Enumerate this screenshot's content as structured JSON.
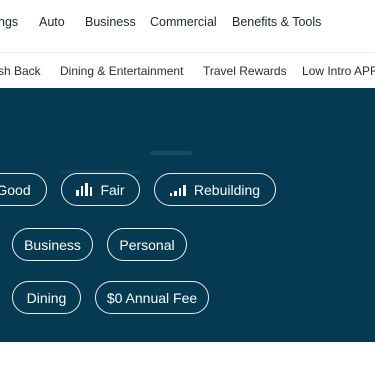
{
  "top_nav": {
    "items": [
      {
        "label": "ngs"
      },
      {
        "label": "Auto"
      },
      {
        "label": "Business"
      },
      {
        "label": "Commercial"
      },
      {
        "label": "Benefits & Tools"
      }
    ]
  },
  "sub_nav": {
    "items": [
      {
        "label": "sh Back"
      },
      {
        "label": "Dining & Entertainment"
      },
      {
        "label": "Travel Rewards"
      },
      {
        "label": "Low Intro APR"
      }
    ]
  },
  "filters": {
    "credit": [
      {
        "label": "Good",
        "icon": ""
      },
      {
        "label": "Fair",
        "icon": "bars-icon"
      },
      {
        "label": "Rebuilding",
        "icon": "bars-icon"
      }
    ],
    "type": [
      {
        "label": "Business"
      },
      {
        "label": "Personal"
      }
    ],
    "feature": [
      {
        "label": "Dining"
      },
      {
        "label": "$0 Annual Fee"
      }
    ]
  },
  "colors": {
    "panel_bg": "#063a52",
    "pill_border": "#e8eef1",
    "text_dark": "#1c2731"
  }
}
